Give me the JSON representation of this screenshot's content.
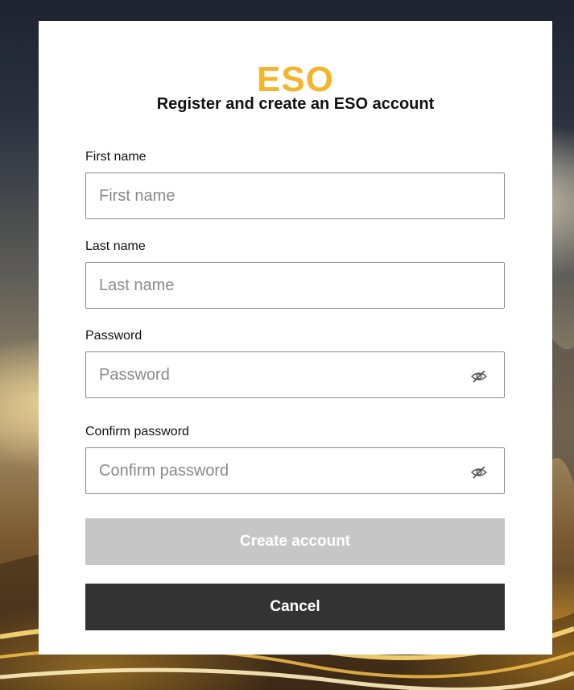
{
  "brand": {
    "logo_text": "ESO",
    "logo_color": "#f5b52a"
  },
  "form": {
    "title": "Register and create an ESO account",
    "fields": [
      {
        "label": "First name",
        "placeholder": "First name",
        "value": ""
      },
      {
        "label": "Last name",
        "placeholder": "Last name",
        "value": ""
      },
      {
        "label": "Password",
        "placeholder": "Password",
        "value": "",
        "icon": "eye-slash-icon"
      },
      {
        "label": "Confirm password",
        "placeholder": "Confirm password",
        "value": "",
        "icon": "eye-slash-icon"
      }
    ],
    "create_label": "Create account",
    "create_enabled": false,
    "cancel_label": "Cancel"
  },
  "colors": {
    "disabled_button": "#c6c6c6",
    "cancel_button": "#333333"
  }
}
